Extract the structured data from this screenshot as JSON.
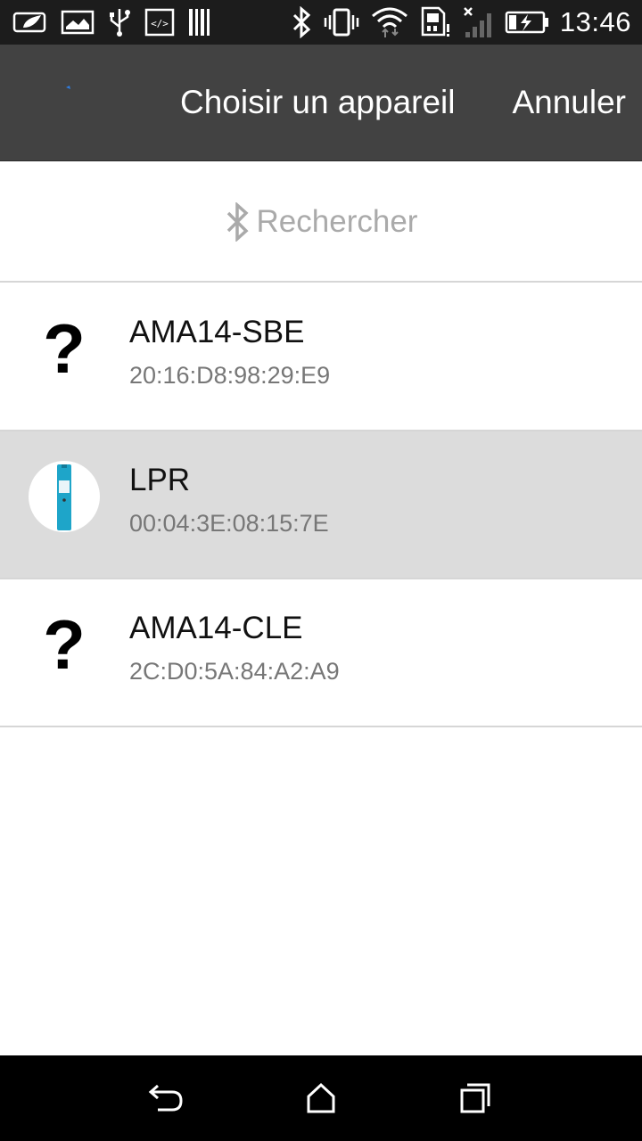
{
  "status_bar": {
    "time": "13:46",
    "left_icons": [
      "leaf-card-icon",
      "image-icon",
      "usb-icon",
      "code-icon",
      "barcode-icon"
    ],
    "right_icons": [
      "bluetooth-icon",
      "vibrate-icon",
      "wifi-icon",
      "sim-alert-icon",
      "no-signal-icon",
      "battery-charging-icon"
    ]
  },
  "action_bar": {
    "title": "Choisir un appareil",
    "cancel_label": "Annuler"
  },
  "search": {
    "label": "Rechercher"
  },
  "devices": [
    {
      "name": "AMA14-SBE",
      "mac": "20:16:D8:98:29:E9",
      "icon": "question-mark-icon",
      "selected": false
    },
    {
      "name": "LPR",
      "mac": "00:04:3E:08:15:7E",
      "icon": "device-thumbnail-icon",
      "selected": true
    },
    {
      "name": "AMA14-CLE",
      "mac": "2C:D0:5A:84:A2:A9",
      "icon": "question-mark-icon",
      "selected": false
    }
  ],
  "colors": {
    "status_bar": "#1c1c1c",
    "action_bar": "#424242",
    "selected_row": "#dcdcdc",
    "device_accent": "#1ea5c9"
  }
}
